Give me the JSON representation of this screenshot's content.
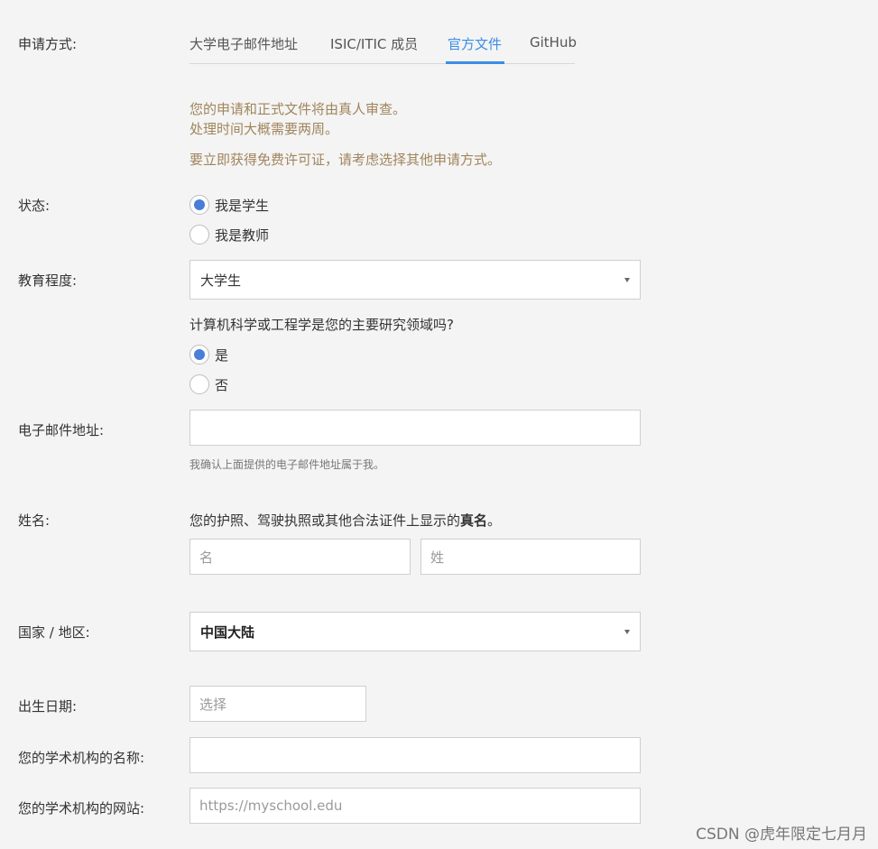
{
  "labels": {
    "method": "申请方式:",
    "status": "状态:",
    "education": "教育程度:",
    "email": "电子邮件地址:",
    "name": "姓名:",
    "country": "国家 / 地区:",
    "birthday": "出生日期:",
    "institution_name": "您的学术机构的名称:",
    "institution_site": "您的学术机构的网站:"
  },
  "tabs": [
    {
      "label": "大学电子邮件地址",
      "active": false
    },
    {
      "label": "ISIC/ITIC 成员",
      "active": false
    },
    {
      "label": "官方文件",
      "active": true
    },
    {
      "label": "GitHub",
      "active": false
    }
  ],
  "notice": {
    "line1": "您的申请和正式文件将由真人审查。",
    "line2": "处理时间大概需要两周。",
    "line3": "要立即获得免费许可证，请考虑选择其他申请方式。"
  },
  "status": {
    "options": [
      {
        "label": "我是学生",
        "checked": true
      },
      {
        "label": "我是教师",
        "checked": false
      }
    ]
  },
  "education": {
    "value": "大学生"
  },
  "cs_question": {
    "text": "计算机科学或工程学是您的主要研究领域吗?",
    "options": [
      {
        "label": "是",
        "checked": true
      },
      {
        "label": "否",
        "checked": false
      }
    ]
  },
  "email": {
    "value": "",
    "confirm_hint": "我确认上面提供的电子邮件地址属于我。"
  },
  "name": {
    "hint_prefix": "您的护照、驾驶执照或其他合法证件上显示的",
    "hint_bold": "真名",
    "hint_suffix": "。",
    "first_placeholder": "名",
    "last_placeholder": "姓"
  },
  "country": {
    "value": "中国大陆"
  },
  "birthday": {
    "placeholder": "选择"
  },
  "institution": {
    "name_value": "",
    "site_placeholder": "https://myschool.edu"
  },
  "watermark": "CSDN @虎年限定七月月",
  "colors": {
    "accent": "#3a8ee6",
    "notice": "#a0855b",
    "radio": "#4a7ed8"
  }
}
